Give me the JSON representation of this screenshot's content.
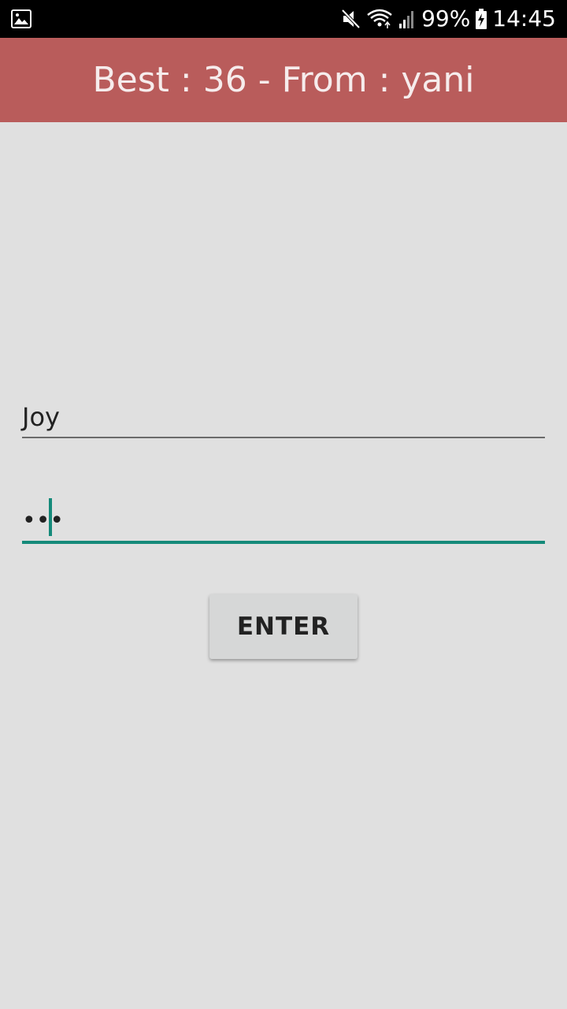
{
  "status_bar": {
    "battery_text": "99%",
    "time": "14:45",
    "icons": [
      "gallery-icon",
      "mute-icon",
      "wifi-icon",
      "signal-icon",
      "battery-charging-icon"
    ]
  },
  "app_bar": {
    "title": "Best : 36 - From : yani",
    "color": "#b95c5b"
  },
  "form": {
    "username_value": "Joy",
    "password_value": "•••",
    "enter_label": "ENTER",
    "accent_color": "#158a7a"
  }
}
